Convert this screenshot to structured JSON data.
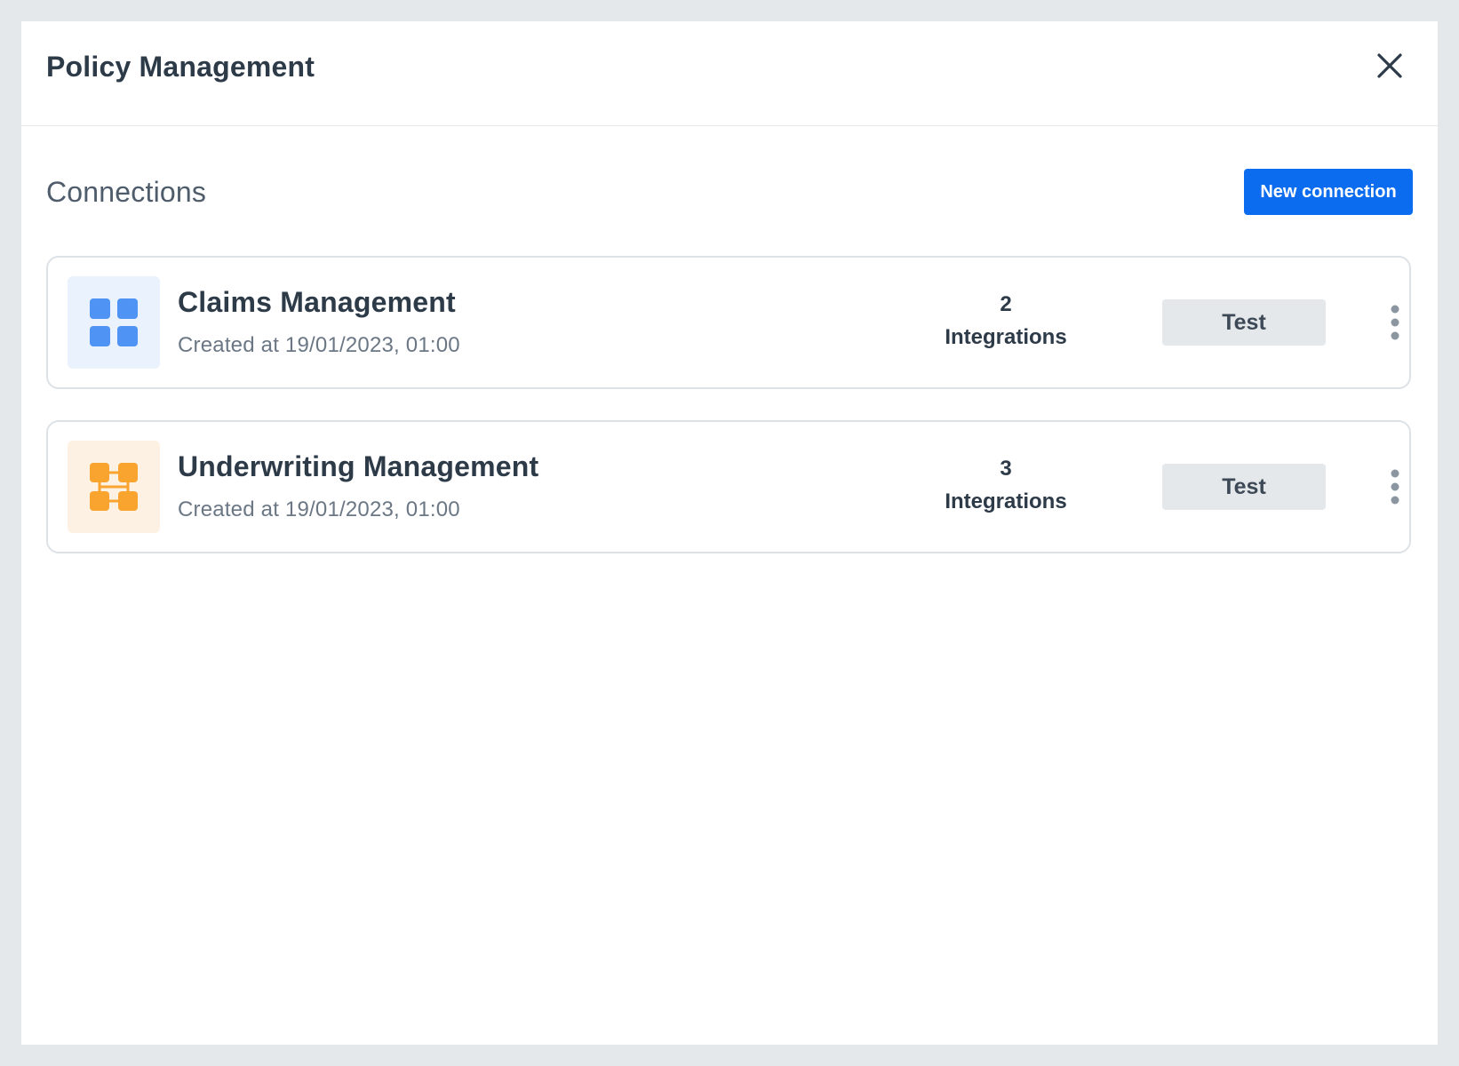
{
  "modal": {
    "title": "Policy Management",
    "close_icon": "close-icon"
  },
  "section": {
    "title": "Connections",
    "new_connection_label": "New connection"
  },
  "connections": [
    {
      "name": "Claims Management",
      "created": "Created at 19/01/2023, 01:00",
      "integrations_count": "2",
      "integrations_label": "Integrations",
      "test_label": "Test",
      "icon": "grid-squares-icon",
      "icon_color": "#4f94f4",
      "icon_bg": "#eaf2fe"
    },
    {
      "name": "Underwriting Management",
      "created": "Created at 19/01/2023, 01:00",
      "integrations_count": "3",
      "integrations_label": "Integrations",
      "test_label": "Test",
      "icon": "connected-nodes-icon",
      "icon_color": "#f8a42e",
      "icon_bg": "#fdf1e3"
    }
  ],
  "colors": {
    "primary": "#0b6cf0",
    "text_dark": "#2d3a48",
    "text_muted": "#6b7785"
  }
}
